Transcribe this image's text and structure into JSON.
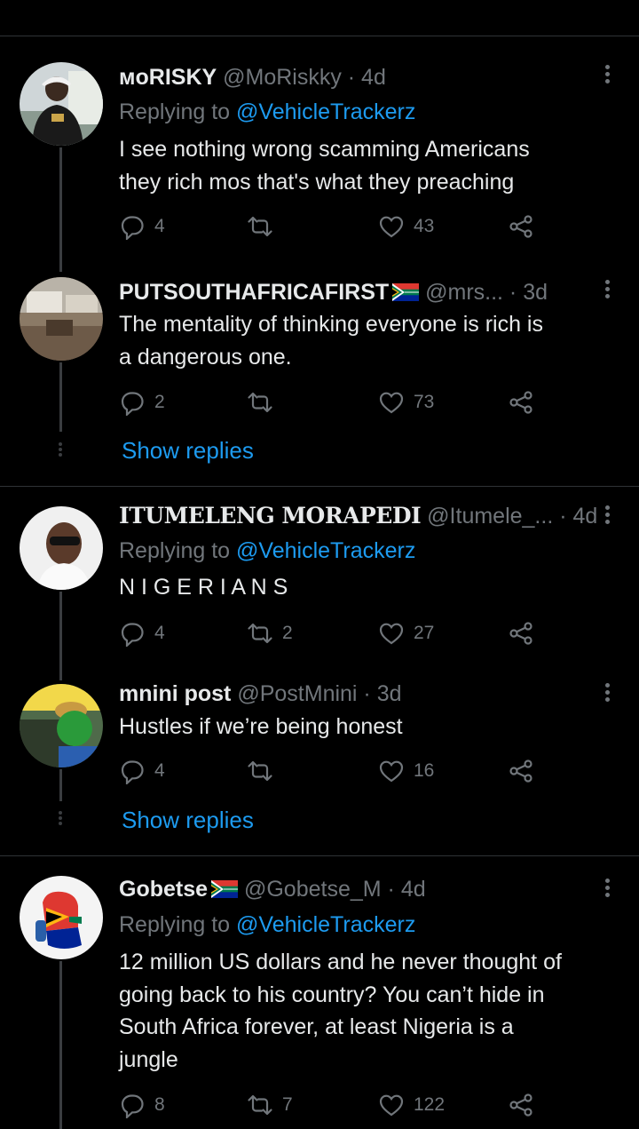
{
  "tweets": [
    {
      "display_name": "ᴍoRISKY",
      "handle_meta": "@MoRiskky · 4d",
      "replying_prefix": "Replying to",
      "replying_to": "@VehicleTrackerz",
      "text_lines": [
        "I see nothing wrong scamming Americans",
        "they rich  mos that's what they preaching"
      ],
      "replies": "4",
      "retweets": "",
      "likes": "43"
    },
    {
      "display_name": "PUTSOUTHAFRICAFIRST",
      "handle_meta": "@mrs... · 3d",
      "text_lines": [
        "The mentality of thinking everyone is rich is",
        "a dangerous one."
      ],
      "replies": "2",
      "retweets": "",
      "likes": "73"
    },
    {
      "display_name": "ITUMELENG MORAPEDI",
      "handle_meta": "@Itumele_... · 4d",
      "replying_prefix": "Replying to",
      "replying_to": "@VehicleTrackerz",
      "text_lines": [
        "N I G E R I A N S"
      ],
      "replies": "4",
      "retweets": "2",
      "likes": "27"
    },
    {
      "display_name": "mnini post",
      "handle_meta": "@PostMnini · 3d",
      "text_lines": [
        "Hustles if we’re being honest"
      ],
      "replies": "4",
      "retweets": "",
      "likes": "16"
    },
    {
      "display_name": "Gobetse",
      "handle_meta": "@Gobetse_M · 4d",
      "replying_prefix": "Replying to",
      "replying_to": "@VehicleTrackerz",
      "text_lines": [
        "12 million US dollars and he never thought of",
        "going back to his country? You can’t hide in",
        "South Africa forever, at least Nigeria is a",
        "jungle"
      ],
      "replies": "8",
      "retweets": "7",
      "likes": "122"
    }
  ],
  "show_replies_label": "Show replies",
  "colors": {
    "accent": "#1d9bf0",
    "muted": "#71767b",
    "text": "#e7e9ea",
    "background": "#000000"
  },
  "icons": [
    "reply-icon",
    "retweet-icon",
    "like-icon",
    "share-icon",
    "more-options-icon",
    "south-africa-flag-icon"
  ]
}
